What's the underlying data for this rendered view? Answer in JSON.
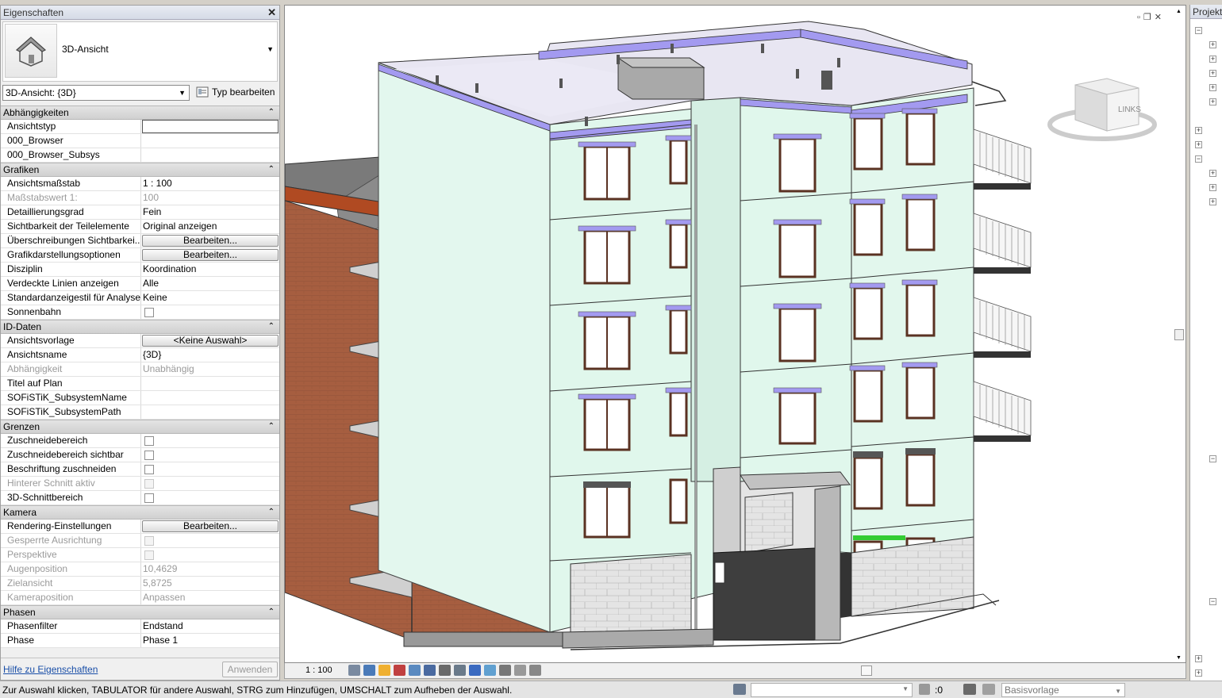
{
  "properties": {
    "title": "Eigenschaften",
    "type_name": "3D-Ansicht",
    "view_selector": "3D-Ansicht: {3D}",
    "edit_type_label": "Typ bearbeiten",
    "sections": [
      {
        "title": "Abhängigkeiten",
        "rows": [
          {
            "key": "Ansichtstyp",
            "value": "",
            "kind": "edit"
          },
          {
            "key": "000_Browser",
            "value": ""
          },
          {
            "key": "000_Browser_Subsys",
            "value": ""
          }
        ]
      },
      {
        "title": "Grafiken",
        "rows": [
          {
            "key": "Ansichtsmaßstab",
            "value": "1 : 100"
          },
          {
            "key": "Maßstabswert 1:",
            "value": "100",
            "disabled": true
          },
          {
            "key": "Detaillierungsgrad",
            "value": "Fein"
          },
          {
            "key": "Sichtbarkeit der Teilelemente",
            "value": "Original anzeigen"
          },
          {
            "key": "Überschreibungen Sichtbarkei...",
            "value": "Bearbeiten...",
            "kind": "button"
          },
          {
            "key": "Grafikdarstellungsoptionen",
            "value": "Bearbeiten...",
            "kind": "button"
          },
          {
            "key": "Disziplin",
            "value": "Koordination"
          },
          {
            "key": "Verdeckte Linien anzeigen",
            "value": "Alle"
          },
          {
            "key": "Standardanzeigestil für Analyse",
            "value": "Keine"
          },
          {
            "key": "Sonnenbahn",
            "value": "",
            "kind": "check"
          }
        ]
      },
      {
        "title": "ID-Daten",
        "rows": [
          {
            "key": "Ansichtsvorlage",
            "value": "<Keine Auswahl>",
            "kind": "button"
          },
          {
            "key": "Ansichtsname",
            "value": "{3D}"
          },
          {
            "key": "Abhängigkeit",
            "value": "Unabhängig",
            "disabled": true
          },
          {
            "key": "Titel auf Plan",
            "value": ""
          },
          {
            "key": "SOFiSTiK_SubsystemName",
            "value": ""
          },
          {
            "key": "SOFiSTiK_SubsystemPath",
            "value": ""
          }
        ]
      },
      {
        "title": "Grenzen",
        "rows": [
          {
            "key": "Zuschneidebereich",
            "value": "",
            "kind": "check"
          },
          {
            "key": "Zuschneidebereich sichtbar",
            "value": "",
            "kind": "check"
          },
          {
            "key": "Beschriftung zuschneiden",
            "value": "",
            "kind": "check"
          },
          {
            "key": "Hinterer Schnitt aktiv",
            "value": "",
            "kind": "check",
            "disabled": true
          },
          {
            "key": "3D-Schnittbereich",
            "value": "",
            "kind": "check"
          }
        ]
      },
      {
        "title": "Kamera",
        "rows": [
          {
            "key": "Rendering-Einstellungen",
            "value": "Bearbeiten...",
            "kind": "button"
          },
          {
            "key": "Gesperrte Ausrichtung",
            "value": "",
            "kind": "check",
            "disabled": true
          },
          {
            "key": "Perspektive",
            "value": "",
            "kind": "check",
            "disabled": true
          },
          {
            "key": "Augenposition",
            "value": "10,4629",
            "disabled": true
          },
          {
            "key": "Zielansicht",
            "value": "5,8725",
            "disabled": true
          },
          {
            "key": "Kameraposition",
            "value": "Anpassen",
            "disabled": true
          }
        ]
      },
      {
        "title": "Phasen",
        "rows": [
          {
            "key": "Phasenfilter",
            "value": "Endstand"
          },
          {
            "key": "Phase",
            "value": "Phase 1"
          }
        ]
      }
    ],
    "help_link": "Hilfe zu Eigenschaften",
    "apply_label": "Anwenden"
  },
  "viewport": {
    "viewcube_label": "LINKS",
    "scale": "1 : 100"
  },
  "browser": {
    "title": "Projekt"
  },
  "status": {
    "message": "Zur Auswahl klicken, TABULATOR für andere Auswahl, STRG zum Hinzufügen, UMSCHALT zum Aufheben der Auswahl.",
    "selection_count": ":0",
    "model_selector": "Basisvorlage"
  },
  "colors": {
    "brick": "#a45c3f",
    "facade": "#dff7ec",
    "parapet": "#a8a0f0",
    "roof": "#e6e4f0",
    "green_band": "#33cc33"
  }
}
